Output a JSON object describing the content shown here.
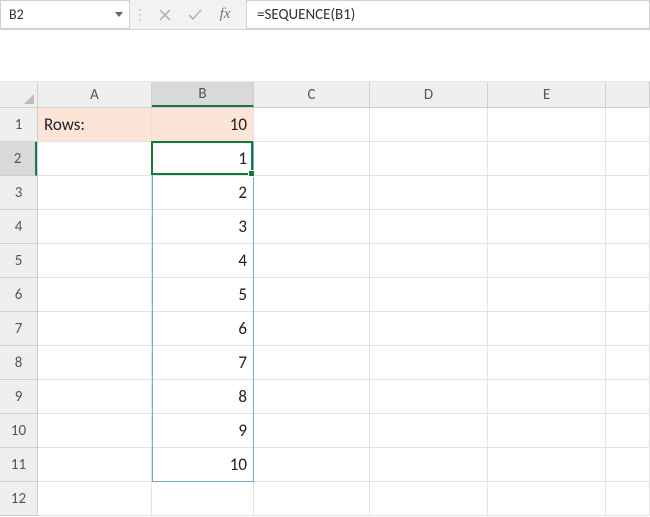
{
  "formula_bar": {
    "name_box": "B2",
    "formula": "=SEQUENCE(B1)",
    "fx_label": "fx"
  },
  "columns": [
    "A",
    "B",
    "C",
    "D",
    "E"
  ],
  "rows": [
    "1",
    "2",
    "3",
    "4",
    "5",
    "6",
    "7",
    "8",
    "9",
    "10",
    "11",
    "12"
  ],
  "active_cell": "B2",
  "selected_column": "B",
  "selected_row": "2",
  "cells": {
    "A1": {
      "value": "Rows:",
      "align": "txt",
      "hl": true
    },
    "B1": {
      "value": "10",
      "align": "num",
      "hl": true
    },
    "B2": {
      "value": "1",
      "align": "num"
    },
    "B3": {
      "value": "2",
      "align": "num"
    },
    "B4": {
      "value": "3",
      "align": "num"
    },
    "B5": {
      "value": "4",
      "align": "num"
    },
    "B6": {
      "value": "5",
      "align": "num"
    },
    "B7": {
      "value": "6",
      "align": "num"
    },
    "B8": {
      "value": "7",
      "align": "num"
    },
    "B9": {
      "value": "8",
      "align": "num"
    },
    "B10": {
      "value": "9",
      "align": "num"
    },
    "B11": {
      "value": "10",
      "align": "num"
    }
  },
  "spill_range": "B2:B11"
}
